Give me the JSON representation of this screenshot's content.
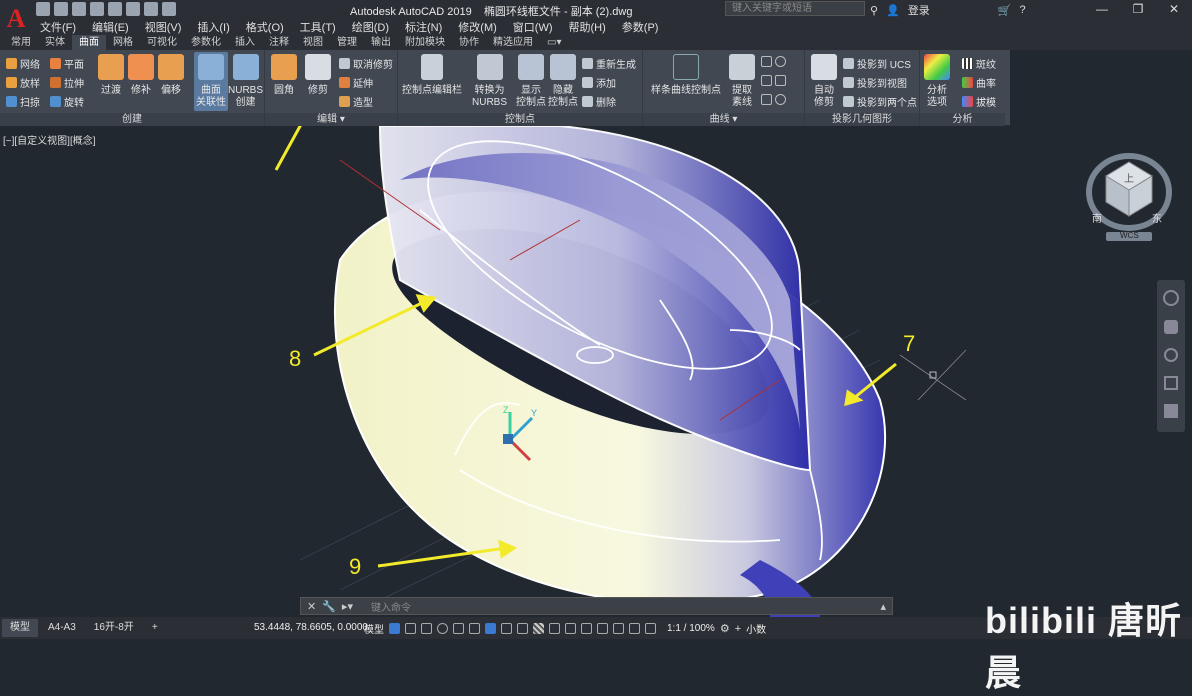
{
  "app": {
    "title": "Autodesk AutoCAD 2019",
    "file": "椭圆环线框文件 - 副本 (2).dwg",
    "search_placeholder": "键入关键字或短语",
    "login": "登录",
    "logo": "A"
  },
  "menus": [
    "文件(F)",
    "编辑(E)",
    "视图(V)",
    "插入(I)",
    "格式(O)",
    "工具(T)",
    "绘图(D)",
    "标注(N)",
    "修改(M)",
    "窗口(W)",
    "帮助(H)",
    "参数(P)"
  ],
  "tabs": [
    "常用",
    "实体",
    "曲面",
    "网格",
    "可视化",
    "参数化",
    "插入",
    "注释",
    "视图",
    "管理",
    "输出",
    "附加模块",
    "协作",
    "精选应用"
  ],
  "active_tab": "曲面",
  "ribbon": {
    "create": {
      "title": "创建",
      "small": [
        "网络",
        "平面",
        "放样",
        "拉伸",
        "扫掠",
        "旋转"
      ],
      "big": [
        "过渡",
        "修补",
        "偏移"
      ],
      "assoc": "曲面\n关联性",
      "nurbs": "NURBS\n创建"
    },
    "edit": {
      "title": "编辑",
      "fillet": "圆角",
      "trim": "修剪",
      "untrim": "取消修剪",
      "extend": "延伸",
      "sculpt": "造型"
    },
    "cv": {
      "title": "控制点",
      "cv_edit": "控制点编辑栏",
      "convert": "转换为\nNURBS",
      "show": "显示\n控制点",
      "hide": "隐藏\n控制点",
      "rebuild": "重新生成",
      "add": "添加",
      "remove": "删除"
    },
    "curves": {
      "title": "曲线",
      "spline": "样条曲线控制点",
      "extract": "提取\n素线"
    },
    "project": {
      "title": "投影几何图形",
      "auto": "自动\n修剪",
      "ucs": "投影到 UCS",
      "view": "投影到视图",
      "two": "投影到两个点"
    },
    "analysis": {
      "title": "分析",
      "options": "分析\n选项",
      "zebra": "斑纹",
      "curvature": "曲率",
      "draft": "拔模"
    }
  },
  "viewport": {
    "label": "[−][自定义视图][概念]",
    "viewcube_top": "上",
    "viewcube_south": "南",
    "viewcube_east": "东",
    "wcs": "WCS",
    "annotations": [
      "8",
      "7",
      "9"
    ]
  },
  "command": {
    "placeholder": "键入命令"
  },
  "status": {
    "layout_tabs": [
      "模型",
      "A4-A3",
      "16开-8开"
    ],
    "add_tab": "+",
    "coords": "53.4448, 78.6605, 0.0000",
    "mode": "模型",
    "scale": "1:1 / 100%",
    "decimal": "小数"
  },
  "watermark": "bilibili 唐昕晨",
  "colors": {
    "annotation": "#f2ea2a",
    "surface_blue": "#3a3ab0",
    "surface_cream": "#f6f6d8"
  }
}
